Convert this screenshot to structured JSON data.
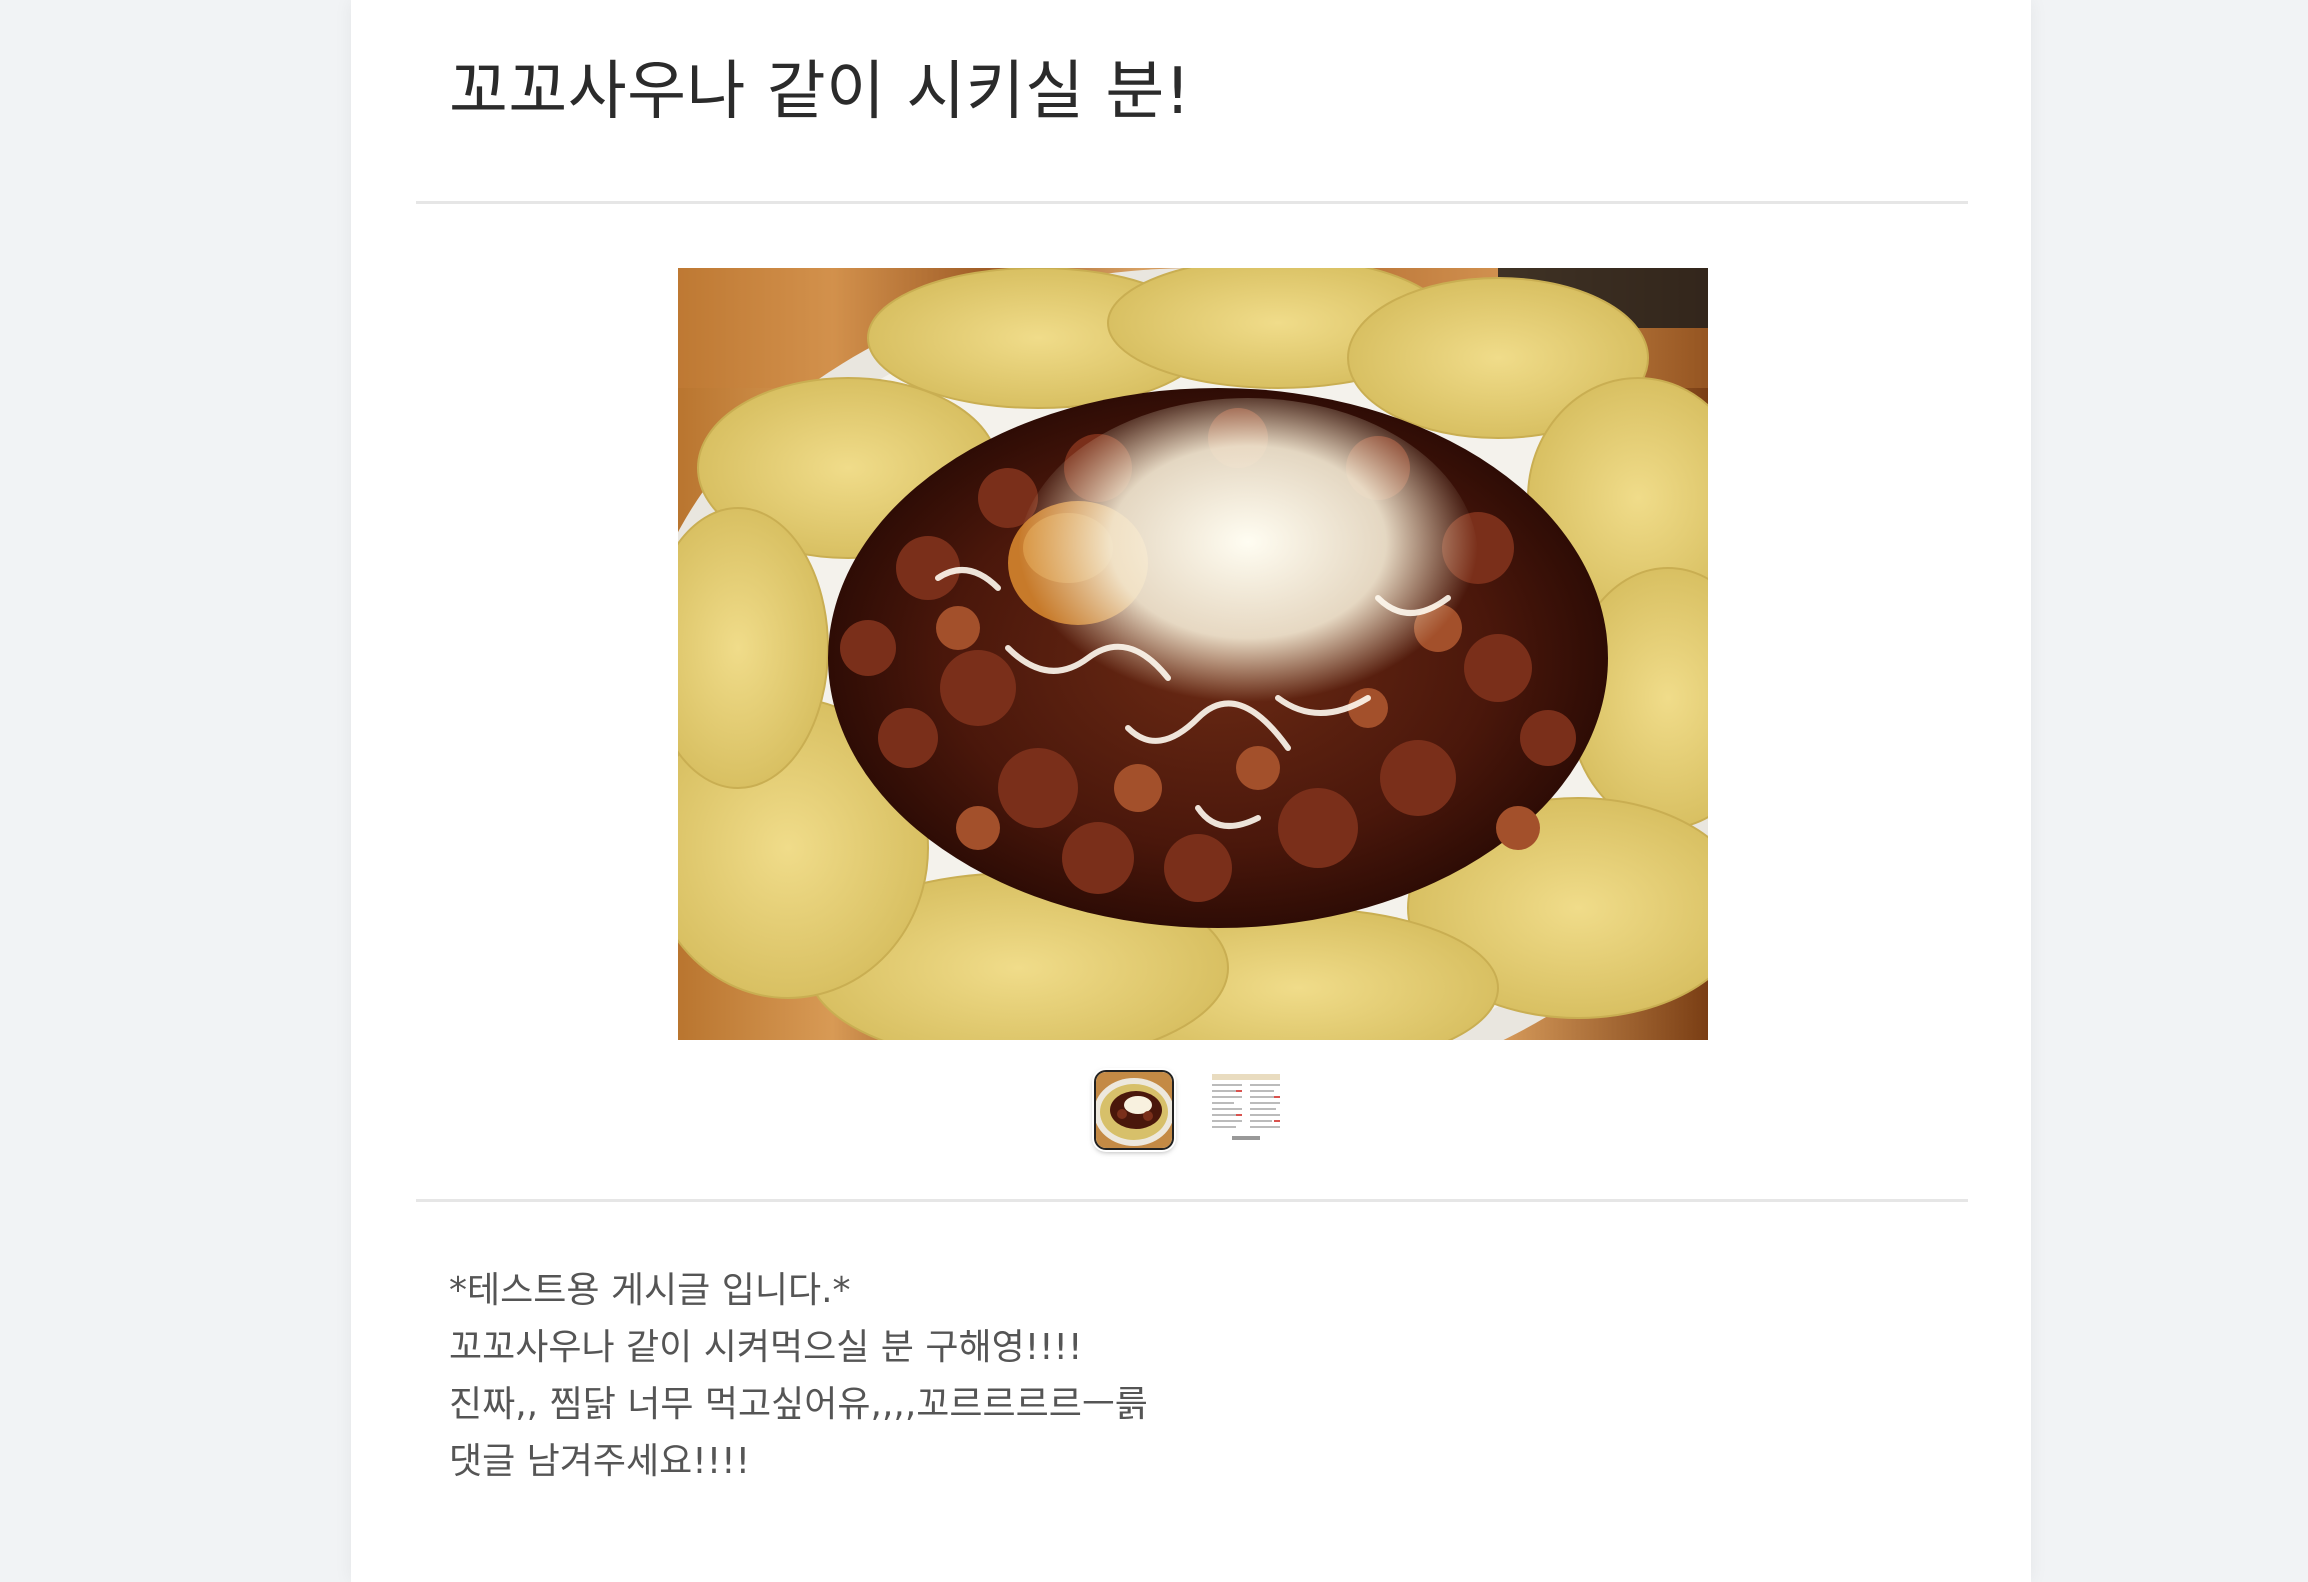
{
  "post": {
    "title": "꼬꼬사우나 같이 시키실 분!",
    "body_lines": [
      "*테스트용 게시글 입니다.*",
      "꼬꼬사우나 같이 시켜먹으실 분 구해영!!!!",
      "진짜,, 찜닭 너무 먹고싶어유,,,,꼬르르르르ㅡ륽",
      "댓글 남겨주세요!!!!"
    ]
  },
  "gallery": {
    "main_image": "jjimdak-with-cheese-photo",
    "thumbnails": [
      {
        "image": "jjimdak-thumbnail",
        "selected": true
      },
      {
        "image": "menu-sheet-thumbnail",
        "selected": false
      }
    ]
  },
  "colors": {
    "page_background": "#f1f3f5",
    "card_background": "#ffffff",
    "divider": "#e6e6e6",
    "title_text": "#2b2b2b",
    "body_text": "#555555"
  }
}
